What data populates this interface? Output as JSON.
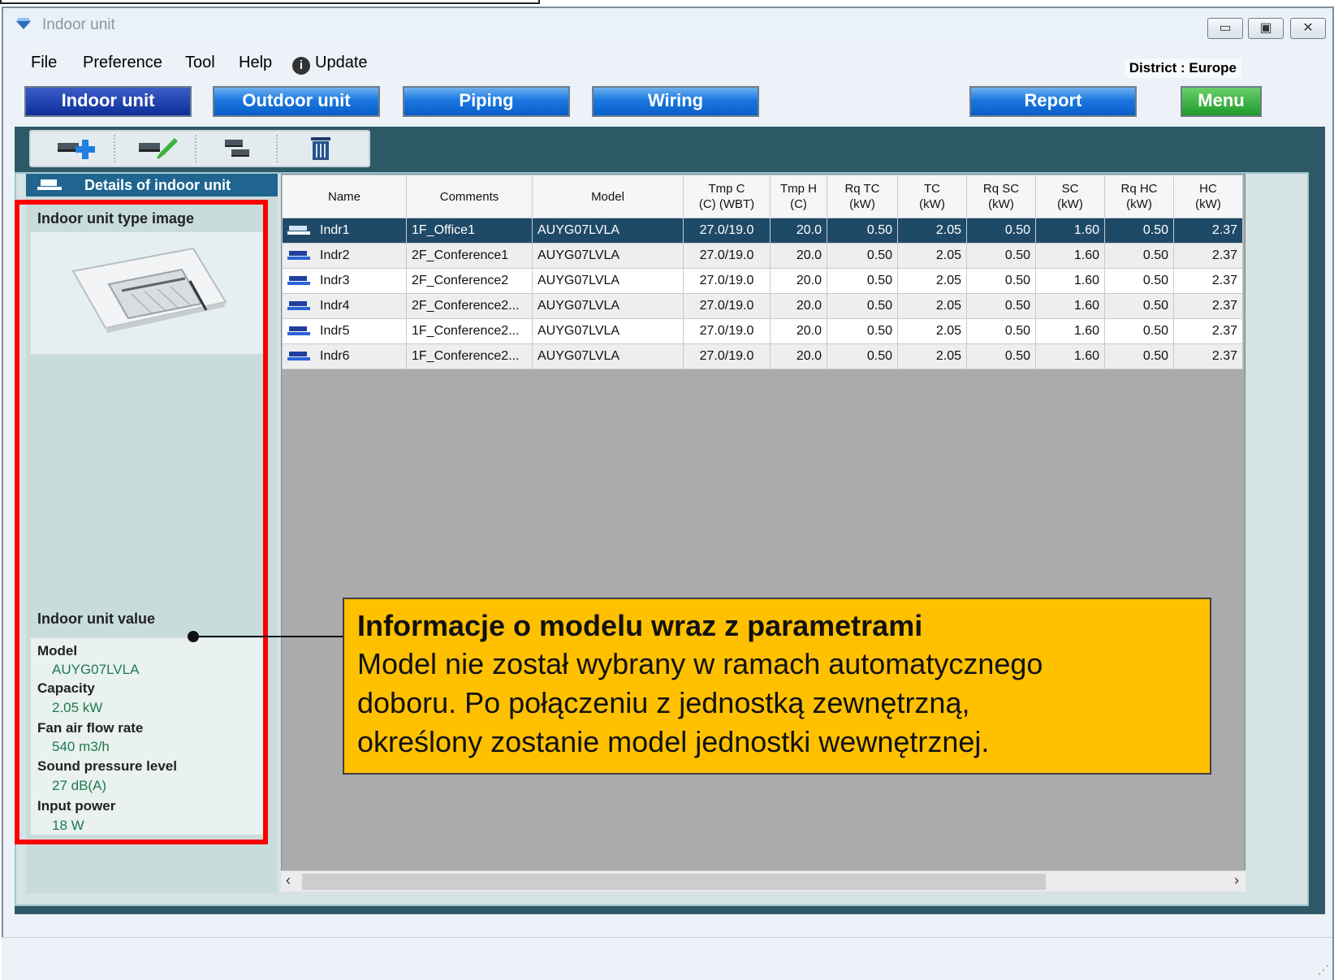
{
  "window": {
    "title": "Indoor unit",
    "controls": [
      "minimize",
      "maximize",
      "close"
    ]
  },
  "menu": {
    "items": [
      "File",
      "Preference",
      "Tool",
      "Help"
    ],
    "update_label": "Update",
    "district": "District : Europe"
  },
  "nav": {
    "indoor": "Indoor unit",
    "outdoor": "Outdoor unit",
    "piping": "Piping",
    "wiring": "Wiring",
    "report": "Report",
    "menu": "Menu"
  },
  "toolbar": {
    "icons": [
      "add-unit-icon",
      "edit-unit-icon",
      "copy-unit-icon",
      "delete-icon"
    ]
  },
  "details": {
    "header": "Details of indoor unit",
    "type_image_label": "Indoor unit type image",
    "value_label": "Indoor unit value",
    "fields": [
      {
        "label": "Model",
        "value": "AUYG07LVLA"
      },
      {
        "label": "Capacity",
        "value": "2.05 kW"
      },
      {
        "label": "Fan air flow rate",
        "value": "540 m3/h"
      },
      {
        "label": "Sound pressure level",
        "value": "27 dB(A)"
      },
      {
        "label": "Input power",
        "value": "18 W"
      }
    ]
  },
  "table": {
    "headers": [
      {
        "l1": "Name",
        "l2": ""
      },
      {
        "l1": "Comments",
        "l2": ""
      },
      {
        "l1": "Model",
        "l2": ""
      },
      {
        "l1": "Tmp C",
        "l2": "(C) (WBT)"
      },
      {
        "l1": "Tmp H",
        "l2": "(C)"
      },
      {
        "l1": "Rq TC",
        "l2": "(kW)"
      },
      {
        "l1": "TC",
        "l2": "(kW)"
      },
      {
        "l1": "Rq SC",
        "l2": "(kW)"
      },
      {
        "l1": "SC",
        "l2": "(kW)"
      },
      {
        "l1": "Rq HC",
        "l2": "(kW)"
      },
      {
        "l1": "HC",
        "l2": "(kW)"
      }
    ],
    "rows": [
      [
        "Indr1",
        "1F_Office1",
        "AUYG07LVLA",
        "27.0/19.0",
        "20.0",
        "0.50",
        "2.05",
        "0.50",
        "1.60",
        "0.50",
        "2.37"
      ],
      [
        "Indr2",
        "2F_Conference1",
        "AUYG07LVLA",
        "27.0/19.0",
        "20.0",
        "0.50",
        "2.05",
        "0.50",
        "1.60",
        "0.50",
        "2.37"
      ],
      [
        "Indr3",
        "2F_Conference2",
        "AUYG07LVLA",
        "27.0/19.0",
        "20.0",
        "0.50",
        "2.05",
        "0.50",
        "1.60",
        "0.50",
        "2.37"
      ],
      [
        "Indr4",
        "2F_Conference2...",
        "AUYG07LVLA",
        "27.0/19.0",
        "20.0",
        "0.50",
        "2.05",
        "0.50",
        "1.60",
        "0.50",
        "2.37"
      ],
      [
        "Indr5",
        "1F_Conference2...",
        "AUYG07LVLA",
        "27.0/19.0",
        "20.0",
        "0.50",
        "2.05",
        "0.50",
        "1.60",
        "0.50",
        "2.37"
      ],
      [
        "Indr6",
        "1F_Conference2...",
        "AUYG07LVLA",
        "27.0/19.0",
        "20.0",
        "0.50",
        "2.05",
        "0.50",
        "1.60",
        "0.50",
        "2.37"
      ]
    ],
    "selected_row": 0
  },
  "callout": {
    "title": "Informacje o modelu wraz z parametrami",
    "lines": [
      "Model nie został wybrany w ramach automatycznego",
      "doboru. Po połączeniu z jednostką zewnętrzną,",
      "określony zostanie model jednostki wewnętrznej."
    ]
  },
  "colors": {
    "nav_active": "#0d2f9a",
    "nav_blue": "#1a78e0",
    "menu_green": "#1f9a2a",
    "highlight_red": "#ff0000",
    "callout_yellow": "#ffc000",
    "selected_row": "#1f4a67"
  }
}
